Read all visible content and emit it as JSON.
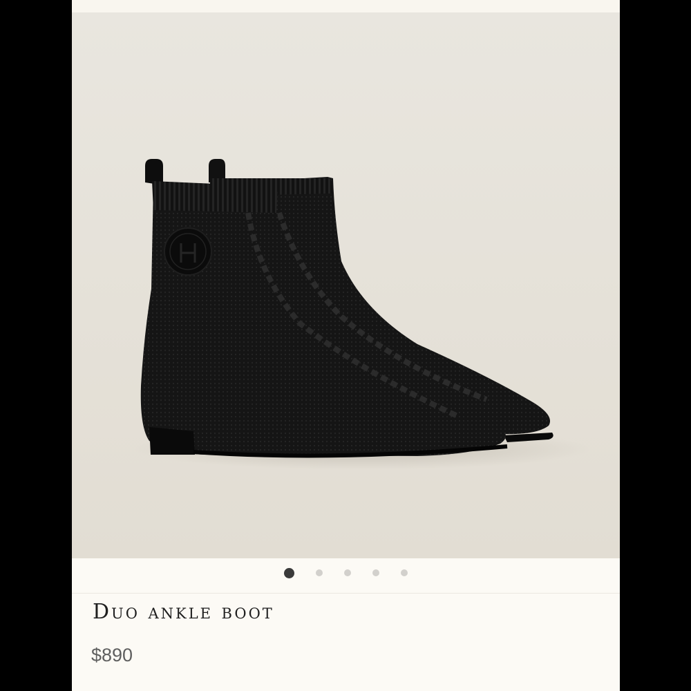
{
  "product": {
    "title": "Duo ankle boot",
    "price": "$890",
    "image_alt": "product-photo"
  },
  "carousel": {
    "total": 5,
    "active_index": 0
  },
  "colors": {
    "background": "#fcfaf5",
    "image_backdrop": "#e6e2da",
    "dot_active": "#3a3a3a",
    "dot_inactive": "#d2d0cc",
    "title_text": "#1f1f1f",
    "price_text": "#5f5f5f"
  }
}
